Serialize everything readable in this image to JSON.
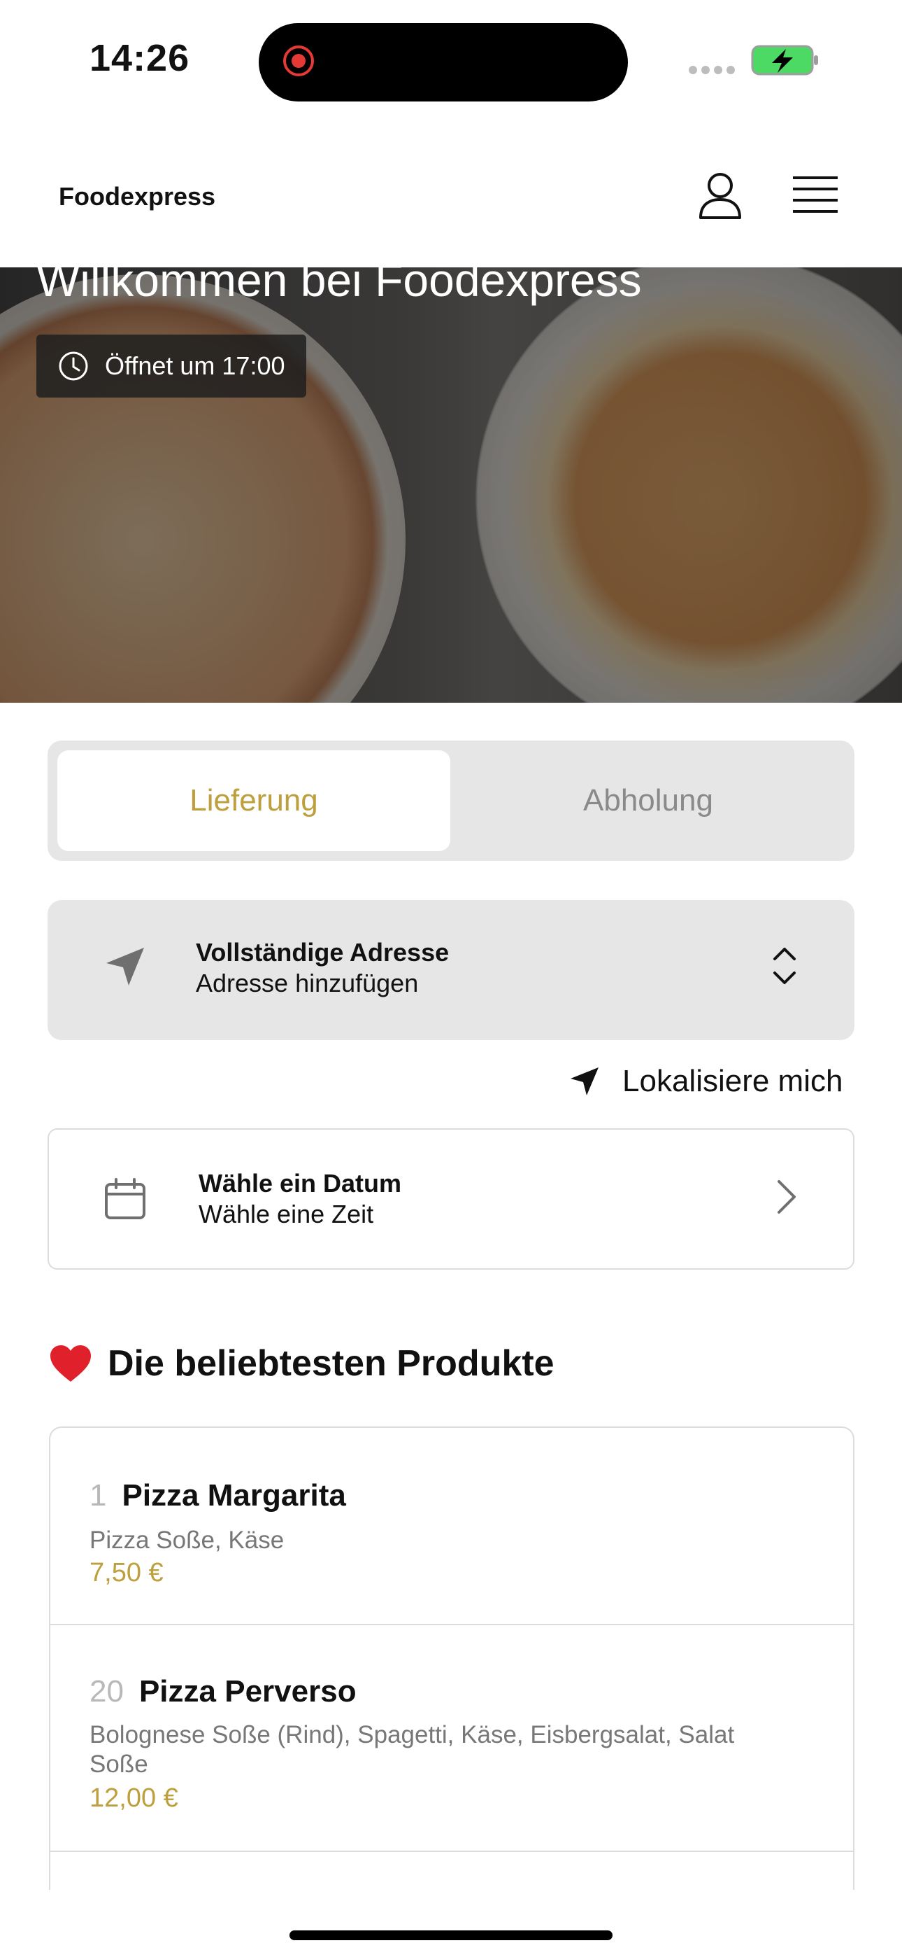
{
  "status_bar": {
    "time": "14:26"
  },
  "header": {
    "title": "Foodexpress"
  },
  "hero": {
    "title": "Willkommen bei Foodexpress",
    "badge": "Öffnet um 17:00"
  },
  "order_mode": {
    "tabs": [
      {
        "label": "Lieferung",
        "selected": true
      },
      {
        "label": "Abholung",
        "selected": false
      }
    ],
    "accent": "#bd9f3d"
  },
  "address": {
    "title": "Vollständige Adresse",
    "subtitle": "Adresse hinzufügen"
  },
  "locate": {
    "label": "Lokalisiere mich"
  },
  "date": {
    "title": "Wähle ein Datum",
    "subtitle": "Wähle eine Zeit"
  },
  "popular": {
    "title": "Die beliebtesten Produkte",
    "items": [
      {
        "number": "1",
        "name": "Pizza Margarita",
        "description": "Pizza Soße, Käse",
        "price": "7,50 €"
      },
      {
        "number": "20",
        "name": "Pizza Perverso",
        "description": "Bolognese Soße (Rind), Spagetti, Käse, Eisbergsalat, Salat Soße",
        "price": "12,00 €"
      }
    ]
  }
}
